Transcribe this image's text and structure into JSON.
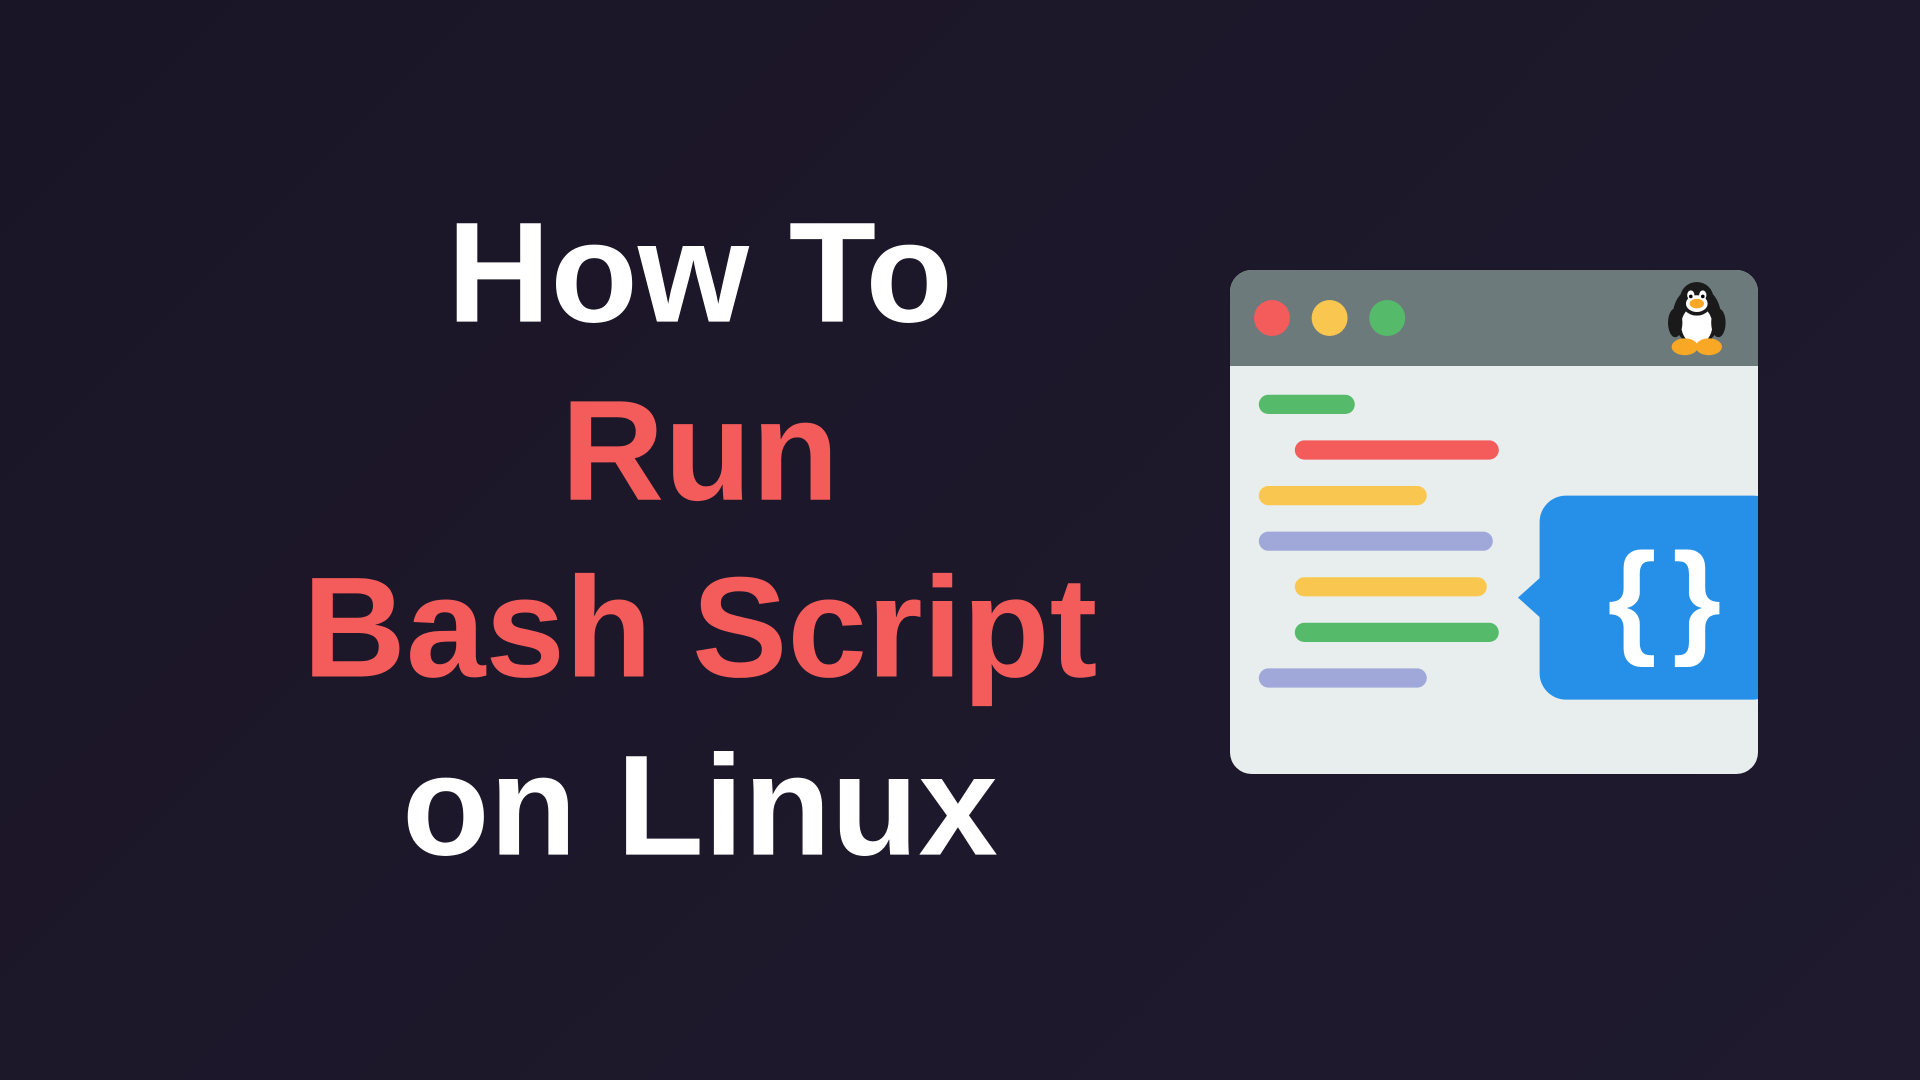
{
  "title": {
    "line1": "How To",
    "line2": "Run",
    "line3": "Bash Script",
    "line4": "on Linux"
  },
  "illustration": {
    "bubble_text": "{ }"
  }
}
